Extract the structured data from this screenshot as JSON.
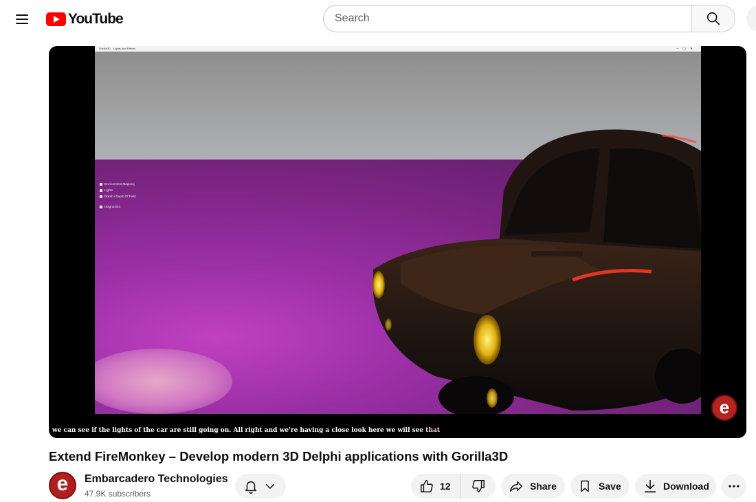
{
  "header": {
    "logo_text": "YouTube",
    "search_placeholder": "Search",
    "icons": {
      "menu": "hamburger-menu-icon",
      "search": "search-icon",
      "logo": "youtube-play-icon"
    }
  },
  "player": {
    "app_window_title": "Gorilla3D – Lights And Effects",
    "options": [
      "Environment Mapping",
      "Lights",
      "Bokeh / Depth Of Field",
      "Diagnostics"
    ],
    "subtitle_main": "we can see if the lights of the car are still going on. All right and we're having a close look here we will see ",
    "subtitle_highlight": "that",
    "watermark_letter": "e"
  },
  "video": {
    "title": "Extend FireMonkey – Develop modern 3D Delphi applications with Gorilla3D"
  },
  "channel": {
    "name": "Embarcadero Technologies",
    "subscribers": "47.9K subscribers",
    "avatar_letter": "e"
  },
  "actions": {
    "like_count": "12",
    "share_label": "Share",
    "save_label": "Save",
    "download_label": "Download"
  },
  "colors": {
    "brand_red": "#ff0000",
    "pill_bg": "#f2f2f2",
    "channel_red": "#b01e1e"
  }
}
